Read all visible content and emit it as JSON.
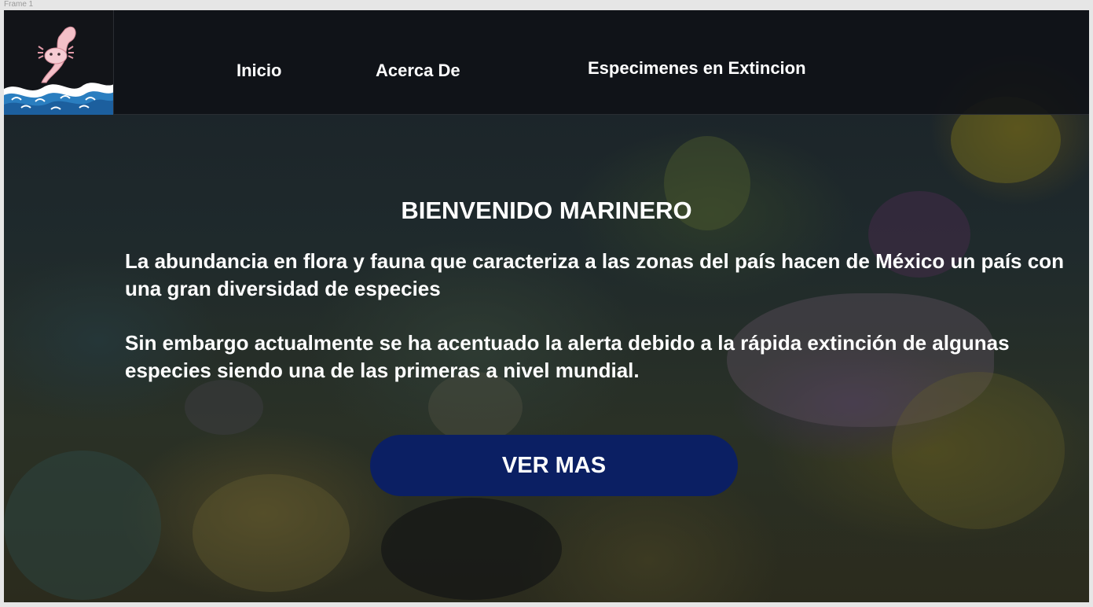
{
  "frame": {
    "label": "Frame 1"
  },
  "nav": {
    "logo": {
      "icon": "axolotl-wave-logo"
    },
    "items": [
      {
        "label": "Inicio"
      },
      {
        "label": "Acerca De"
      },
      {
        "label": "Especimenes en Extincion"
      }
    ]
  },
  "hero": {
    "title": "BIENVENIDO MARINERO",
    "paragraph1": "La abundancia en flora y fauna que caracteriza a las zonas del país hacen de México un  país con una gran diversidad de especies",
    "paragraph2": "Sin embargo actualmente se ha acentuado la  alerta debido a la rápida extinción de algunas especies siendo una de las primeras a nivel mundial.",
    "cta_label": "VER MAS"
  },
  "colors": {
    "nav_background": "#101216",
    "cta_background": "#0b1f63",
    "text": "#ffffff"
  }
}
